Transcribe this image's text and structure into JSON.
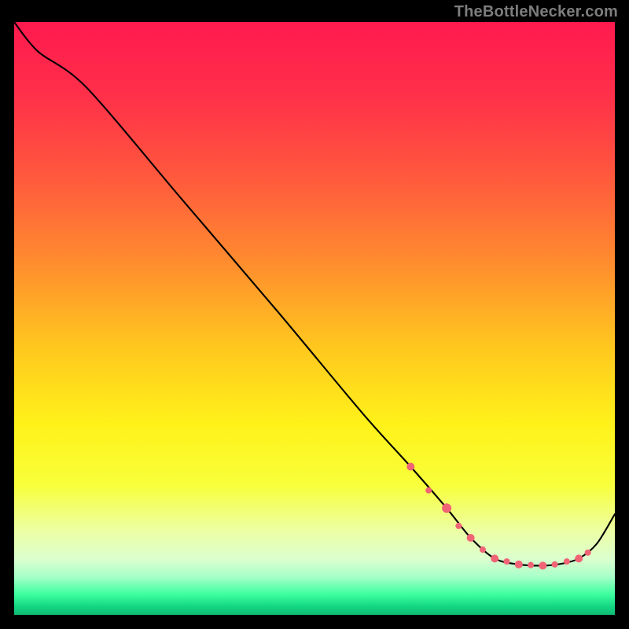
{
  "attribution": "TheBottleNecker.com",
  "colors": {
    "bg": "#000000",
    "attribution_text": "#7d7d7d",
    "curve_stroke": "#000000",
    "marker_fill": "#f06475",
    "gradient_stops": [
      {
        "offset": 0.0,
        "color": "#ff1a4e"
      },
      {
        "offset": 0.12,
        "color": "#ff2f4a"
      },
      {
        "offset": 0.25,
        "color": "#ff553e"
      },
      {
        "offset": 0.4,
        "color": "#ff8a2f"
      },
      {
        "offset": 0.55,
        "color": "#ffc81e"
      },
      {
        "offset": 0.68,
        "color": "#fff21a"
      },
      {
        "offset": 0.78,
        "color": "#f8ff3a"
      },
      {
        "offset": 0.86,
        "color": "#ecffa6"
      },
      {
        "offset": 0.905,
        "color": "#dcffce"
      },
      {
        "offset": 0.935,
        "color": "#a9ffc9"
      },
      {
        "offset": 0.965,
        "color": "#3effa0"
      },
      {
        "offset": 0.985,
        "color": "#14d884"
      },
      {
        "offset": 1.0,
        "color": "#0fba72"
      }
    ]
  },
  "chart_data": {
    "type": "line",
    "title": "",
    "xlabel": "",
    "ylabel": "",
    "xlim": [
      0,
      100
    ],
    "ylim": [
      0,
      100
    ],
    "series": [
      {
        "name": "bottleneck-curve",
        "x": [
          0,
          4,
          12,
          28,
          44,
          58,
          66,
          72,
          76,
          80,
          84,
          88,
          91,
          94,
          97,
          100
        ],
        "y": [
          100,
          95,
          89,
          70,
          51,
          34,
          25,
          18,
          13,
          9.5,
          8.5,
          8.3,
          8.6,
          9.5,
          12,
          17
        ]
      }
    ],
    "markers": {
      "name": "highlight-cluster",
      "points": [
        {
          "x": 66,
          "y": 25,
          "r": 5
        },
        {
          "x": 69,
          "y": 21,
          "r": 4
        },
        {
          "x": 72,
          "y": 18,
          "r": 6
        },
        {
          "x": 74,
          "y": 15,
          "r": 4
        },
        {
          "x": 76,
          "y": 13,
          "r": 5
        },
        {
          "x": 78,
          "y": 11,
          "r": 4
        },
        {
          "x": 80,
          "y": 9.5,
          "r": 5
        },
        {
          "x": 82,
          "y": 9,
          "r": 4
        },
        {
          "x": 84,
          "y": 8.5,
          "r": 5
        },
        {
          "x": 86,
          "y": 8.4,
          "r": 4
        },
        {
          "x": 88,
          "y": 8.3,
          "r": 5
        },
        {
          "x": 90,
          "y": 8.5,
          "r": 4
        },
        {
          "x": 92,
          "y": 9,
          "r": 4
        },
        {
          "x": 94,
          "y": 9.5,
          "r": 5
        },
        {
          "x": 95.5,
          "y": 10.5,
          "r": 4
        }
      ]
    }
  }
}
